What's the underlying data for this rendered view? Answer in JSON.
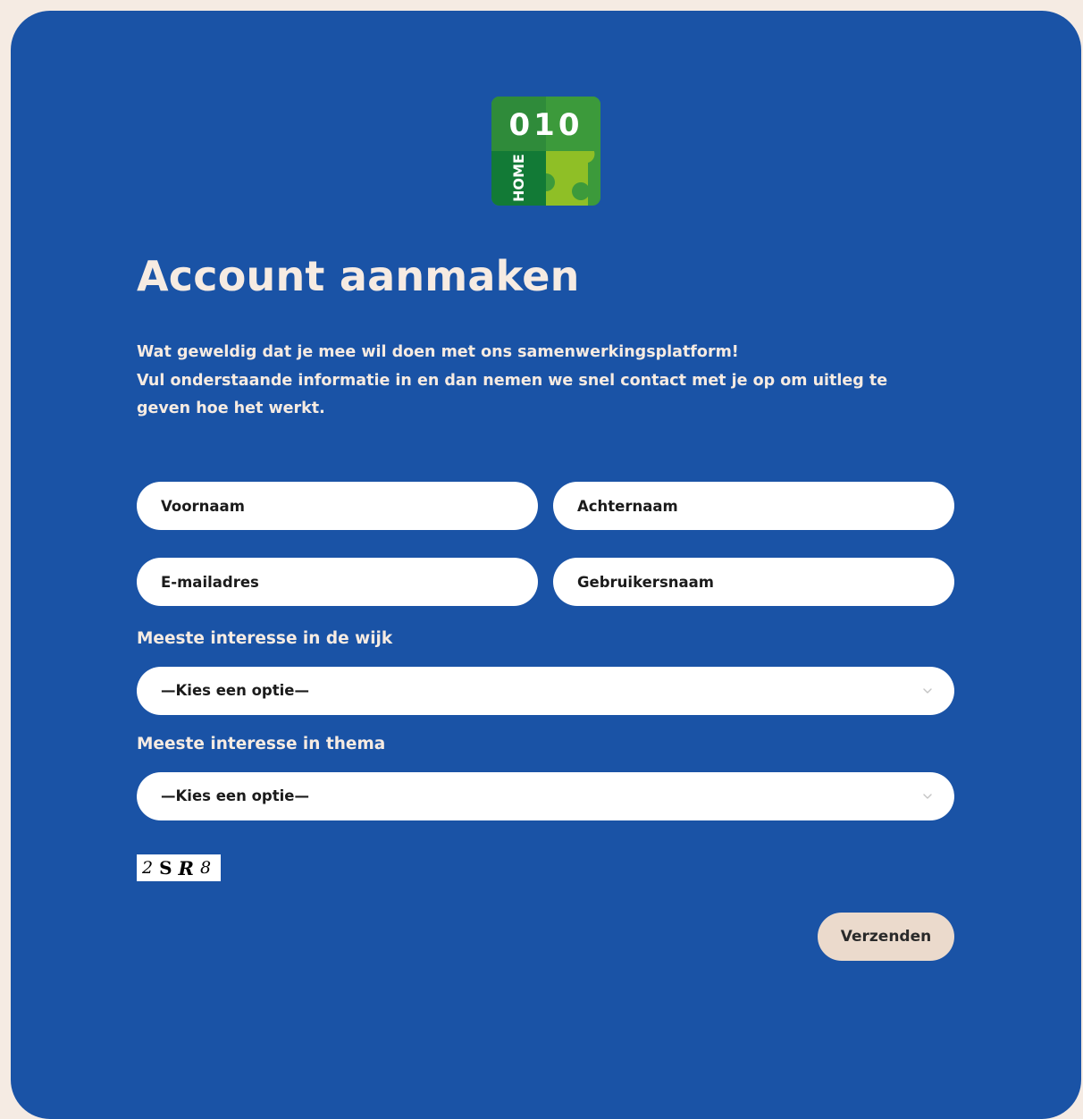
{
  "page": {
    "title": "Account aanmaken",
    "intro": [
      "Wat geweldig dat je mee wil doen met ons samenwerkingsplatform!",
      "Vul onderstaande informatie in en dan nemen we snel contact met je op om uitleg te geven hoe het werkt."
    ]
  },
  "logo": {
    "number": "010",
    "word": "HOME"
  },
  "form": {
    "first_name_placeholder": "Voornaam",
    "last_name_placeholder": "Achternaam",
    "email_placeholder": "E-mailadres",
    "username_placeholder": "Gebruikersnaam",
    "wijk_label": "Meeste interesse in de wijk",
    "wijk_selected": "—Kies een optie—",
    "thema_label": "Meeste interesse in thema",
    "thema_selected": "—Kies een optie—",
    "captcha_chars": [
      "2",
      "S",
      "R",
      "8"
    ],
    "submit_label": "Verzenden"
  },
  "colors": {
    "page_background": "#f5ebe3",
    "card_background": "#1a53a6",
    "text_light": "#f6ebe2",
    "button_background": "#ebdacc",
    "logo_dark_green": "#127a36",
    "logo_mid_green": "#3c9a3b",
    "logo_light_green": "#8fbf26"
  }
}
